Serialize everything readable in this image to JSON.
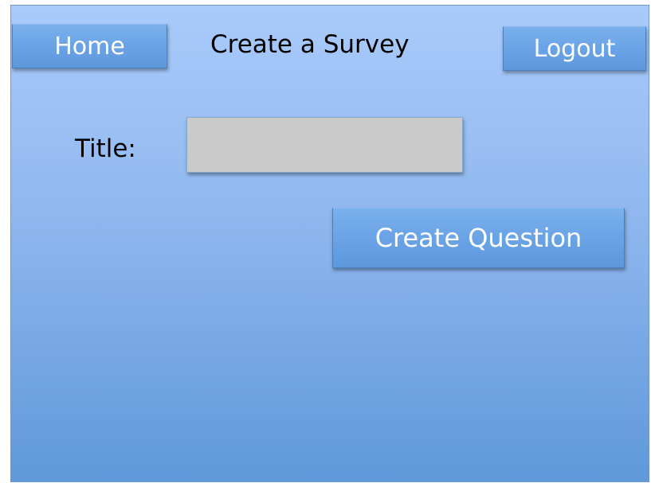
{
  "header": {
    "home_label": "Home",
    "page_title": "Create a Survey",
    "logout_label": "Logout"
  },
  "form": {
    "title_label": "Title:",
    "title_value": "",
    "create_question_label": "Create Question"
  },
  "colors": {
    "panel_top": "#a9cbfb",
    "panel_bottom": "#5f98da",
    "button": "#6aa3e6",
    "input_background": "#cacaca"
  }
}
